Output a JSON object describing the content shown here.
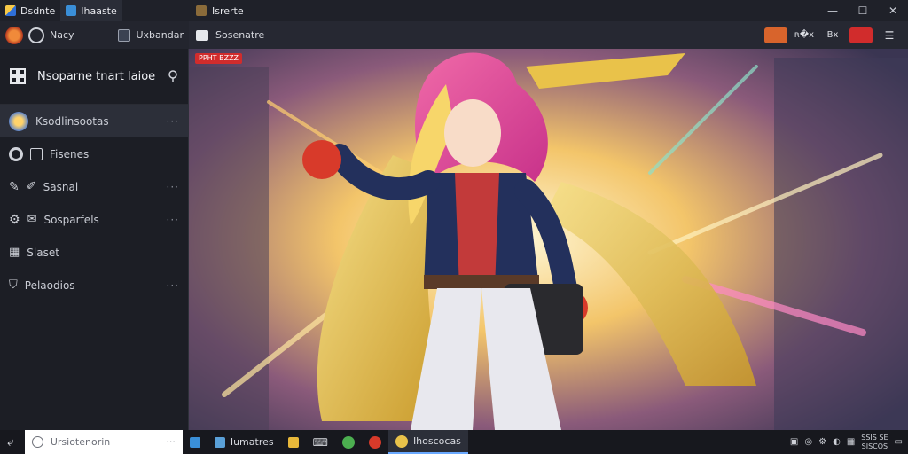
{
  "left_window": {
    "tabs": [
      {
        "label": "Dsdnte"
      },
      {
        "label": "Ihaaste"
      }
    ],
    "toolbar": {
      "item1": "Nacy",
      "item2": "Uxbandar"
    }
  },
  "sidebar": {
    "header": "Nsoparne tnart laioe",
    "items": [
      {
        "label": "Ksodlinsootas",
        "more": "···"
      },
      {
        "label": "Fisenes"
      },
      {
        "label": "Sasnal",
        "more": "···"
      },
      {
        "label": "Sosparfels",
        "more": "···"
      },
      {
        "label": "Slaset"
      },
      {
        "label": "Pelaodios",
        "more": "···"
      }
    ]
  },
  "right_window": {
    "title": "Isrerte",
    "toolbar_label": "Sosenatre",
    "badge": "PPHT BZZZ",
    "toolbar_buttons": [
      "",
      "ʀ�x",
      "Bx",
      ""
    ]
  },
  "taskbar": {
    "search_placeholder": "Ursiotenorin",
    "apps": [
      {
        "label": "Iumatres"
      },
      {
        "label": "Ihoscocas"
      }
    ],
    "clock_line1": "SSIS SE",
    "clock_line2": "SISCOS"
  },
  "colors": {
    "accent": "#6aa9ff",
    "badge": "#d12c2c"
  }
}
